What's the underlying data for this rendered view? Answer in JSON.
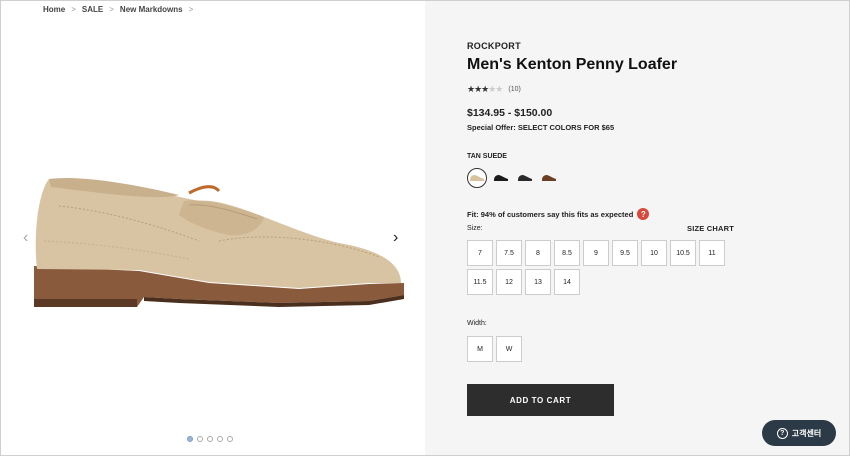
{
  "breadcrumb": {
    "items": [
      "Home",
      "SALE",
      "New Markdowns"
    ],
    "separator": ">"
  },
  "gallery": {
    "prev_icon": "chevron-left-icon",
    "next_icon": "chevron-right-icon",
    "dots_count": 5,
    "active_dot": 1
  },
  "product": {
    "brand": "ROCKPORT",
    "title": "Men's Kenton Penny Loafer",
    "stars_filled": 3,
    "stars_total": 5,
    "review_count": "(10)",
    "price": "$134.95 - $150.00",
    "offer": "Special Offer: SELECT COLORS FOR $65",
    "color_label": "TAN SUEDE",
    "swatch_colors": [
      "#d8c2a0",
      "#1b1b1b",
      "#2a2a2a",
      "#6a3f24"
    ],
    "fit_text": "Fit: 94% of customers say this fits as expected",
    "fit_icon": "question-icon",
    "size_label": "Size:",
    "size_chart": "SIZE CHART",
    "sizes": [
      "7",
      "7.5",
      "8",
      "8.5",
      "9",
      "9.5",
      "10",
      "10.5",
      "11",
      "11.5",
      "12",
      "13",
      "14"
    ],
    "width_label": "Width:",
    "widths": [
      "M",
      "W"
    ],
    "add_to_cart": "ADD TO CART"
  },
  "support": {
    "label": "고객센터",
    "icon": "question-icon"
  },
  "colors": {
    "button_dark": "#2d2d2d",
    "panel_bg": "#f5f5f5",
    "fit_icon_red": "#d9483b",
    "support_bg": "#2c3a47"
  }
}
